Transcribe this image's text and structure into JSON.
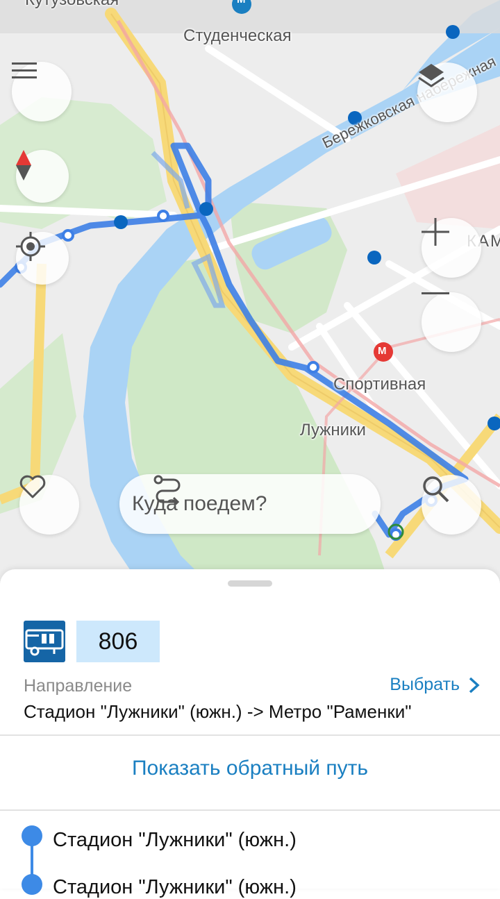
{
  "map": {
    "labels": {
      "kutuzovskaya": "Кутузовская",
      "studencheskaya": "Студенческая",
      "berezhkovskaya": "Бережковская набережная",
      "sportivnaya": "Спортивная",
      "luzhniki": "Лужники",
      "edge_label": "КАМО"
    },
    "metro_glyph": "М",
    "colors": {
      "water": "#aad3f5",
      "park": "#cfe8c6",
      "route": "#3d7fe6",
      "stop": "#0a66bf",
      "metro": "#e53935",
      "road_major": "#f7d978"
    }
  },
  "controls": {
    "menu_icon": "menu-icon",
    "compass_icon": "compass-icon",
    "locate_icon": "my-location-icon",
    "layers_icon": "layers-icon",
    "zoom_in_icon": "plus-icon",
    "zoom_out_icon": "minus-icon",
    "favorite_icon": "heart-icon",
    "search_icon": "search-icon"
  },
  "search": {
    "placeholder": "Куда поедем?",
    "icon": "route-icon"
  },
  "sheet": {
    "transport_icon": "bus-icon",
    "route_number": "806",
    "direction_label": "Направление",
    "choose_label": "Выбрать",
    "direction_value": "Стадион \"Лужники\" (южн.) -> Метро \"Раменки\"",
    "reverse_label": "Показать обратный путь",
    "stops": [
      {
        "name": "Стадион \"Лужники\" (южн.)"
      },
      {
        "name": "Стадион \"Лужники\" (южн.)"
      }
    ]
  }
}
